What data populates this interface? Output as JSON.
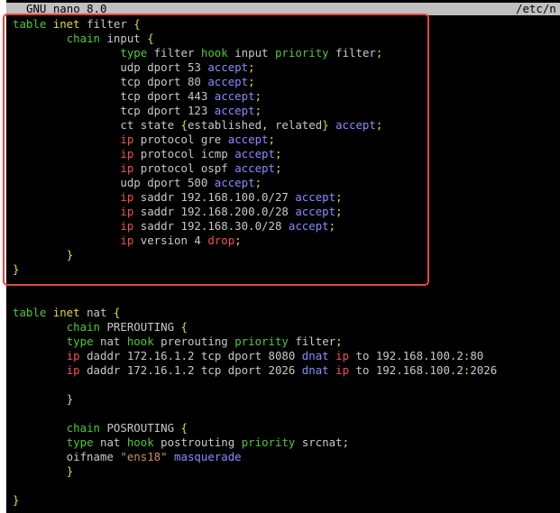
{
  "titlebar": {
    "app_label": "GNU nano 8.0",
    "file_label": "/etc/n"
  },
  "lines": [
    [
      {
        "t": "table ",
        "c": "kw-g"
      },
      {
        "t": "inet ",
        "c": "kw-y"
      },
      {
        "t": "filter ",
        "c": ""
      },
      {
        "t": "{",
        "c": "kw-y"
      }
    ],
    [
      {
        "t": "        ",
        "c": ""
      },
      {
        "t": "chain ",
        "c": "kw-g"
      },
      {
        "t": "input ",
        "c": ""
      },
      {
        "t": "{",
        "c": "kw-y"
      }
    ],
    [
      {
        "t": "                ",
        "c": ""
      },
      {
        "t": "type ",
        "c": "kw-g"
      },
      {
        "t": "filter ",
        "c": ""
      },
      {
        "t": "hook ",
        "c": "kw-g"
      },
      {
        "t": "input ",
        "c": ""
      },
      {
        "t": "priority ",
        "c": "kw-g"
      },
      {
        "t": "filter",
        "c": ""
      },
      {
        "t": ";",
        "c": "kw-y"
      }
    ],
    [
      {
        "t": "                udp dport 53 ",
        "c": ""
      },
      {
        "t": "accept",
        "c": "kw-b"
      },
      {
        "t": ";",
        "c": "kw-y"
      }
    ],
    [
      {
        "t": "                tcp dport 80 ",
        "c": ""
      },
      {
        "t": "accept",
        "c": "kw-b"
      },
      {
        "t": ";",
        "c": "kw-y"
      }
    ],
    [
      {
        "t": "                tcp dport 443 ",
        "c": ""
      },
      {
        "t": "accept",
        "c": "kw-b"
      },
      {
        "t": ";",
        "c": "kw-y"
      }
    ],
    [
      {
        "t": "                tcp dport 123 ",
        "c": ""
      },
      {
        "t": "accept",
        "c": "kw-b"
      },
      {
        "t": ";",
        "c": "kw-y"
      }
    ],
    [
      {
        "t": "                ct state ",
        "c": ""
      },
      {
        "t": "{",
        "c": "kw-y"
      },
      {
        "t": "established, related",
        "c": ""
      },
      {
        "t": "} ",
        "c": "kw-y"
      },
      {
        "t": "accept",
        "c": "kw-b"
      },
      {
        "t": ";",
        "c": "kw-y"
      }
    ],
    [
      {
        "t": "                ",
        "c": ""
      },
      {
        "t": "ip ",
        "c": "kw-r"
      },
      {
        "t": "protocol gre ",
        "c": ""
      },
      {
        "t": "accept",
        "c": "kw-b"
      },
      {
        "t": ";",
        "c": "kw-y"
      }
    ],
    [
      {
        "t": "                ",
        "c": ""
      },
      {
        "t": "ip ",
        "c": "kw-r"
      },
      {
        "t": "protocol icmp ",
        "c": ""
      },
      {
        "t": "accept",
        "c": "kw-b"
      },
      {
        "t": ";",
        "c": "kw-y"
      }
    ],
    [
      {
        "t": "                ",
        "c": ""
      },
      {
        "t": "ip ",
        "c": "kw-r"
      },
      {
        "t": "protocol ospf ",
        "c": ""
      },
      {
        "t": "accept",
        "c": "kw-b"
      },
      {
        "t": ";",
        "c": "kw-y"
      }
    ],
    [
      {
        "t": "                udp dport 500 ",
        "c": ""
      },
      {
        "t": "accept",
        "c": "kw-b"
      },
      {
        "t": ";",
        "c": "kw-y"
      }
    ],
    [
      {
        "t": "                ",
        "c": ""
      },
      {
        "t": "ip ",
        "c": "kw-r"
      },
      {
        "t": "saddr 192.168.100.0/27 ",
        "c": ""
      },
      {
        "t": "accept",
        "c": "kw-b"
      },
      {
        "t": ";",
        "c": "kw-y"
      }
    ],
    [
      {
        "t": "                ",
        "c": ""
      },
      {
        "t": "ip ",
        "c": "kw-r"
      },
      {
        "t": "saddr 192.168.200.0/28 ",
        "c": ""
      },
      {
        "t": "accept",
        "c": "kw-b"
      },
      {
        "t": ";",
        "c": "kw-y"
      }
    ],
    [
      {
        "t": "                ",
        "c": ""
      },
      {
        "t": "ip ",
        "c": "kw-r"
      },
      {
        "t": "saddr 192.168.30.0/28 ",
        "c": ""
      },
      {
        "t": "accept",
        "c": "kw-b"
      },
      {
        "t": ";",
        "c": "kw-y"
      }
    ],
    [
      {
        "t": "                ",
        "c": ""
      },
      {
        "t": "ip ",
        "c": "kw-r"
      },
      {
        "t": "version 4 ",
        "c": ""
      },
      {
        "t": "drop",
        "c": "kw-r"
      },
      {
        "t": ";",
        "c": "kw-y"
      }
    ],
    [
      {
        "t": "        ",
        "c": ""
      },
      {
        "t": "}",
        "c": "kw-y"
      }
    ],
    [
      {
        "t": "}",
        "c": "kw-y"
      }
    ],
    [],
    [],
    [
      {
        "t": "table ",
        "c": "kw-g"
      },
      {
        "t": "inet ",
        "c": "kw-y"
      },
      {
        "t": "nat ",
        "c": ""
      },
      {
        "t": "{",
        "c": "kw-y"
      }
    ],
    [
      {
        "t": "        ",
        "c": ""
      },
      {
        "t": "chain ",
        "c": "kw-g"
      },
      {
        "t": "PREROUTING ",
        "c": ""
      },
      {
        "t": "{",
        "c": "kw-y"
      }
    ],
    [
      {
        "t": "        ",
        "c": ""
      },
      {
        "t": "type ",
        "c": "kw-g"
      },
      {
        "t": "nat ",
        "c": ""
      },
      {
        "t": "hook ",
        "c": "kw-g"
      },
      {
        "t": "prerouting ",
        "c": ""
      },
      {
        "t": "priority ",
        "c": "kw-g"
      },
      {
        "t": "filter",
        "c": ""
      },
      {
        "t": ";",
        "c": "kw-y"
      }
    ],
    [
      {
        "t": "        ",
        "c": ""
      },
      {
        "t": "ip ",
        "c": "kw-r"
      },
      {
        "t": "daddr 172.16.1.2 tcp dport 8080 ",
        "c": ""
      },
      {
        "t": "dnat ",
        "c": "kw-b"
      },
      {
        "t": "ip ",
        "c": "kw-r"
      },
      {
        "t": "to 192.168.100.2",
        "c": ""
      },
      {
        "t": ":",
        "c": "kw-y"
      },
      {
        "t": "80",
        "c": ""
      }
    ],
    [
      {
        "t": "        ",
        "c": ""
      },
      {
        "t": "ip ",
        "c": "kw-r"
      },
      {
        "t": "daddr 172.16.1.2 tcp dport 2026 ",
        "c": ""
      },
      {
        "t": "dnat ",
        "c": "kw-b"
      },
      {
        "t": "ip ",
        "c": "kw-r"
      },
      {
        "t": "to 192.168.100.2",
        "c": ""
      },
      {
        "t": ":",
        "c": "kw-y"
      },
      {
        "t": "2026",
        "c": ""
      }
    ],
    [],
    [
      {
        "t": "        ",
        "c": ""
      },
      {
        "t": "}",
        "c": "kw-y"
      }
    ],
    [],
    [
      {
        "t": "        ",
        "c": ""
      },
      {
        "t": "chain ",
        "c": "kw-g"
      },
      {
        "t": "POSROUTING ",
        "c": ""
      },
      {
        "t": "{",
        "c": "kw-y"
      }
    ],
    [
      {
        "t": "        ",
        "c": ""
      },
      {
        "t": "type ",
        "c": "kw-g"
      },
      {
        "t": "nat ",
        "c": ""
      },
      {
        "t": "hook ",
        "c": "kw-g"
      },
      {
        "t": "postrouting ",
        "c": ""
      },
      {
        "t": "priority ",
        "c": "kw-g"
      },
      {
        "t": "srcnat",
        "c": ""
      },
      {
        "t": ";",
        "c": "kw-y"
      }
    ],
    [
      {
        "t": "        oifname ",
        "c": ""
      },
      {
        "t": "\"ens18\" ",
        "c": "str"
      },
      {
        "t": "masquerade",
        "c": "kw-b"
      }
    ],
    [
      {
        "t": "        ",
        "c": ""
      },
      {
        "t": "}",
        "c": "kw-y"
      }
    ],
    [],
    [
      {
        "t": "}",
        "c": "kw-y"
      }
    ]
  ]
}
